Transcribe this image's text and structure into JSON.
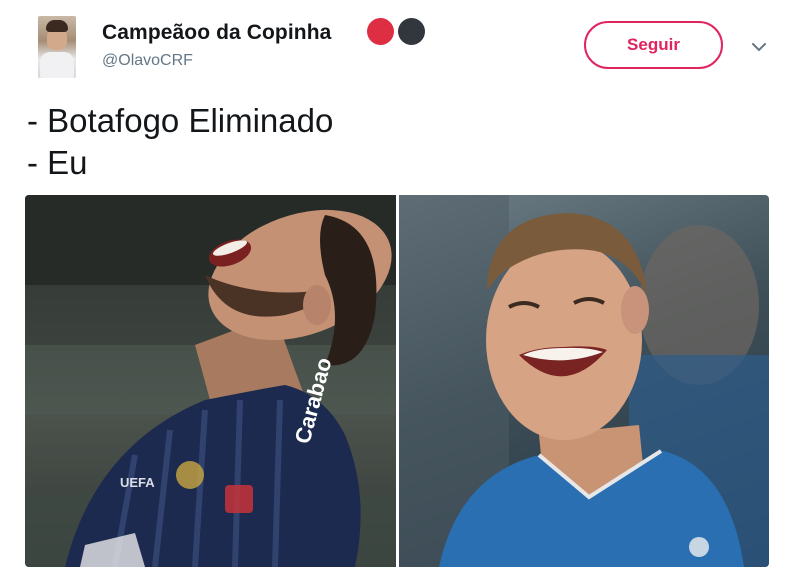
{
  "user": {
    "display_name": "Campeãoo da Copinha",
    "handle": "@OlavoCRF",
    "name_emojis": [
      "red-circle",
      "black-circle"
    ]
  },
  "actions": {
    "follow_label": "Seguir",
    "menu_icon": "chevron-down-icon"
  },
  "tweet": {
    "lines": [
      "- Botafogo Eliminado",
      "- Eu"
    ]
  },
  "media": {
    "photos": [
      {
        "jersey_texts": [
          "Carabao",
          "UEFA"
        ]
      },
      {
        "jersey_texts": []
      }
    ]
  },
  "colors": {
    "follow_accent": "#e0245e",
    "handle_gray": "#657786",
    "text": "#14171a"
  }
}
